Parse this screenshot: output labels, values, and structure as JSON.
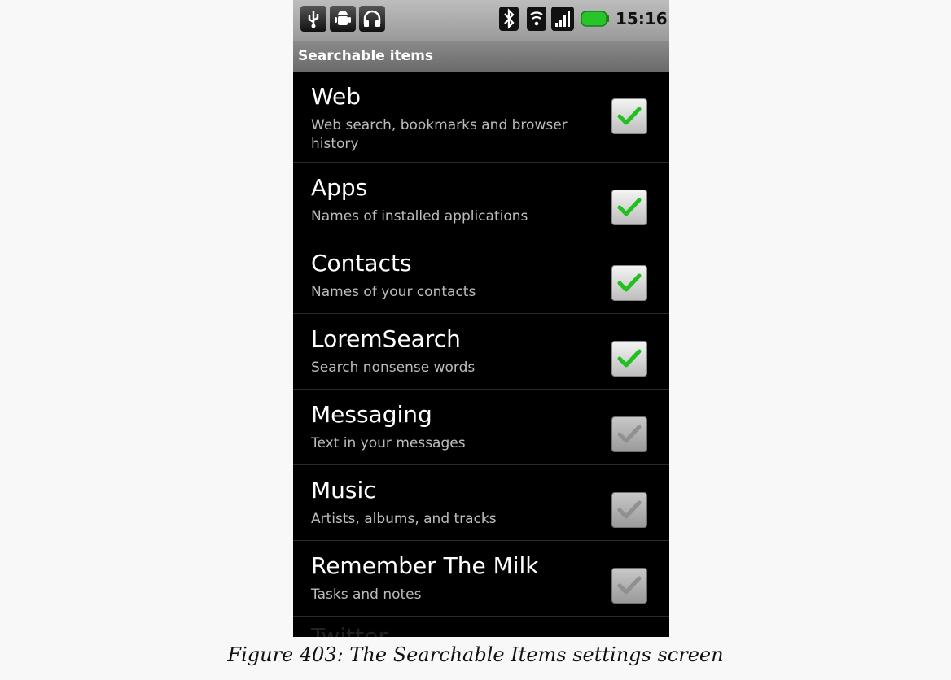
{
  "status_bar": {
    "time": "15:16",
    "icons": [
      "usb-icon",
      "android-debug-icon",
      "headset-icon",
      "bluetooth-icon",
      "wifi-icon",
      "signal-icon",
      "battery-icon"
    ]
  },
  "screen_title": "Searchable items",
  "items": [
    {
      "title": "Web",
      "subtitle": "Web search, bookmarks and browser history",
      "checked": true
    },
    {
      "title": "Apps",
      "subtitle": "Names of installed applications",
      "checked": true
    },
    {
      "title": "Contacts",
      "subtitle": "Names of your contacts",
      "checked": true
    },
    {
      "title": "LoremSearch",
      "subtitle": "Search nonsense words",
      "checked": true
    },
    {
      "title": "Messaging",
      "subtitle": "Text in your messages",
      "checked": false
    },
    {
      "title": "Music",
      "subtitle": "Artists, albums, and tracks",
      "checked": false
    },
    {
      "title": "Remember The Milk",
      "subtitle": "Tasks and notes",
      "checked": false
    }
  ],
  "caption": "Figure 403: The Searchable Items settings screen",
  "colors": {
    "checked_mark": "#22c01e",
    "unchecked_mark": "#b0b0b0",
    "list_bg": "#000000"
  }
}
